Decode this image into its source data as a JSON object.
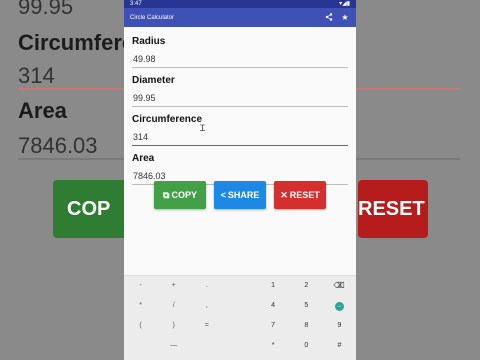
{
  "status": {
    "time": "3:47",
    "icons": "▾◢▮"
  },
  "appbar": {
    "title": "Circle Calculator",
    "share_icon": "share-icon",
    "star_icon": "star-icon"
  },
  "fields": [
    {
      "label": "Radius",
      "value": "49.98"
    },
    {
      "label": "Diameter",
      "value": "99.95"
    },
    {
      "label": "Circumference",
      "value": "314"
    },
    {
      "label": "Area",
      "value": "7846.03"
    }
  ],
  "buttons": {
    "copy": "COPY",
    "share": "SHARE",
    "reset": "RESET"
  },
  "keyboard": {
    "rows": [
      [
        "-",
        "+",
        ".",
        "",
        "1",
        "2",
        "3"
      ],
      [
        "*",
        "/",
        ",",
        "",
        "4",
        "5",
        "6"
      ],
      [
        "(",
        ")",
        "=",
        "",
        "7",
        "8",
        "9"
      ],
      [
        "",
        "—",
        "",
        "",
        "*",
        "0",
        "#"
      ]
    ],
    "backspace": "⌫",
    "enter": "→"
  },
  "background": {
    "top_value": "99.95",
    "label_circ": "Circumference",
    "value_circ": "314",
    "label_area": "Area",
    "value_area": "7846.03",
    "copy_partial": "COP",
    "reset_partial": "RESET"
  },
  "colors": {
    "primary": "#3f51b5",
    "primary_dark": "#283593",
    "copy": "#43a047",
    "share": "#1e88e5",
    "reset": "#d32f2f",
    "error": "#e53935"
  }
}
